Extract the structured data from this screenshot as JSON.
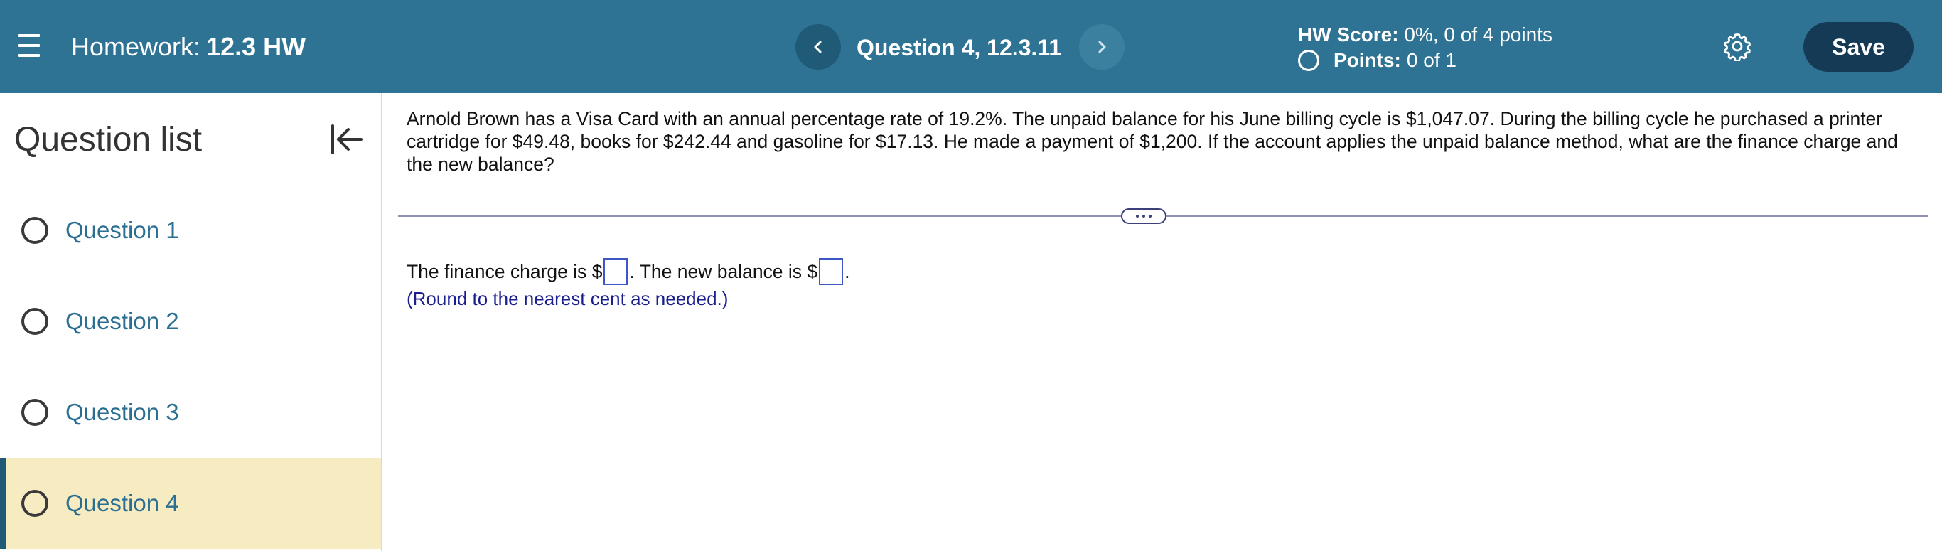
{
  "header": {
    "homework_label": "Homework:",
    "homework_name": "12.3 HW",
    "question_title": "Question 4, 12.3.11",
    "hw_score_label": "HW Score:",
    "hw_score_value": "0%, 0 of 4 points",
    "points_label": "Points:",
    "points_value": "0 of 1",
    "save_label": "Save",
    "prev_icon": "<",
    "next_icon": ">",
    "colors": {
      "bar": "#2f7394",
      "save": "#143a55"
    }
  },
  "sidebar": {
    "title": "Question list",
    "items": [
      {
        "label": "Question 1"
      },
      {
        "label": "Question 2"
      },
      {
        "label": "Question 3"
      },
      {
        "label": "Question 4",
        "active": true
      }
    ],
    "active_color": "#f7ebc1"
  },
  "main": {
    "question_text": "Arnold Brown has a Visa Card with an annual percentage rate of 19.2%. The unpaid balance for his June billing cycle is $1,047.07. During the billing cycle he purchased a printer cartridge for $49.48, books for $242.44 and gasoline for $17.13. He made a payment of $1,200. If the account applies the unpaid balance method, what are the finance charge and the new balance?",
    "answer_part1": "The finance charge is $",
    "answer_part2": ". The new balance is $",
    "answer_part3": ".",
    "round_note": "(Round to the nearest cent as needed.)"
  }
}
